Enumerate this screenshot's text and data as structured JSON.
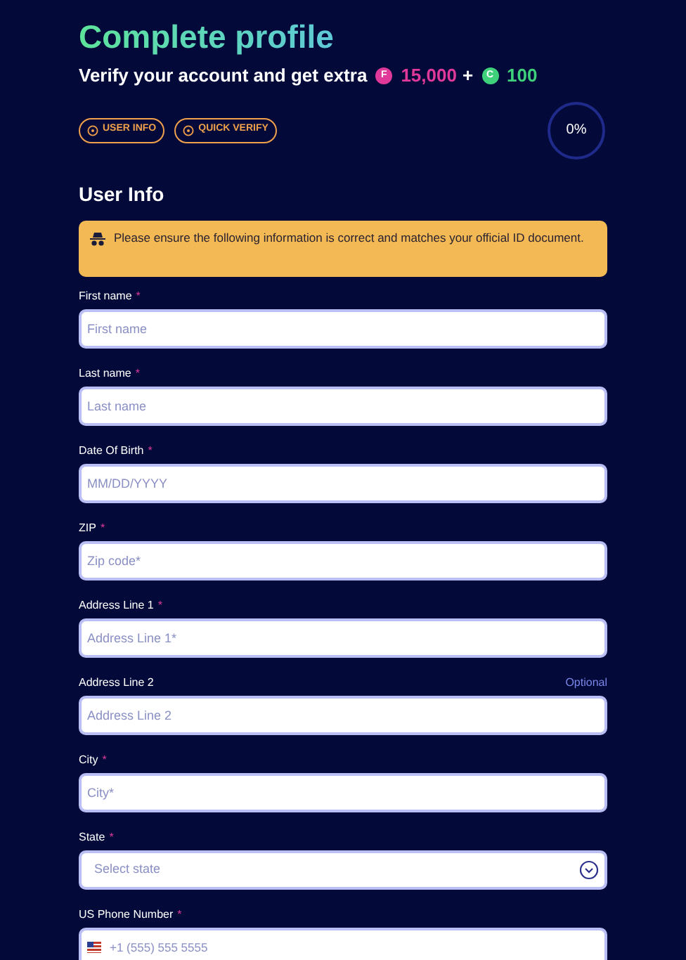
{
  "header": {
    "title": "Complete profile",
    "subtitle": "Verify your account and get extra",
    "reward_1": {
      "icon_letter": "F",
      "amount": "15,000",
      "color": "#e0399a"
    },
    "plus": "+",
    "reward_2": {
      "icon_letter": "C",
      "amount": "100",
      "color": "#3ed07a"
    }
  },
  "steps": [
    {
      "label": "USER INFO"
    },
    {
      "label": "QUICK VERIFY"
    }
  ],
  "progress": {
    "reading": "0%"
  },
  "section_title": "User Info",
  "notice": "Please ensure the following information is correct and matches your official ID document.",
  "fields": [
    {
      "kind": "text",
      "label": "First name",
      "required_mark": "*",
      "placeholder": "First name"
    },
    {
      "kind": "text",
      "label": "Last name",
      "required_mark": "*",
      "placeholder": "Last name"
    },
    {
      "kind": "text",
      "label": "Date Of Birth",
      "required_mark": "*",
      "placeholder": "MM/DD/YYYY"
    },
    {
      "kind": "text",
      "label": "ZIP",
      "required_mark": "*",
      "placeholder": "Zip code*"
    },
    {
      "kind": "text",
      "label": "Address Line 1",
      "required_mark": "*",
      "placeholder": "Address Line 1*"
    },
    {
      "kind": "text",
      "label": "Address Line 2",
      "note": "Optional",
      "placeholder": "Address Line 2"
    },
    {
      "kind": "text",
      "label": "City",
      "required_mark": "*",
      "placeholder": "City*"
    },
    {
      "kind": "select",
      "label": "State",
      "required_mark": "*",
      "placeholder": "Select state"
    },
    {
      "kind": "phone",
      "label": "US Phone Number",
      "required_mark": "*",
      "placeholder": "+1 (555) 555 5555"
    }
  ]
}
